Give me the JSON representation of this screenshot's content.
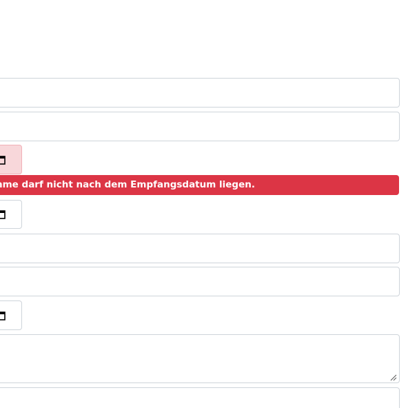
{
  "form": {
    "error_message": "hme darf nicht nach dem Empfangsdatum liegen.",
    "calendar_icon": "calendar-icon",
    "resize_icon": "resize-grip-icon"
  },
  "colors": {
    "error_background": "#dc3545",
    "invalid_addon_background": "#f8d7da",
    "border": "#ced4da"
  }
}
